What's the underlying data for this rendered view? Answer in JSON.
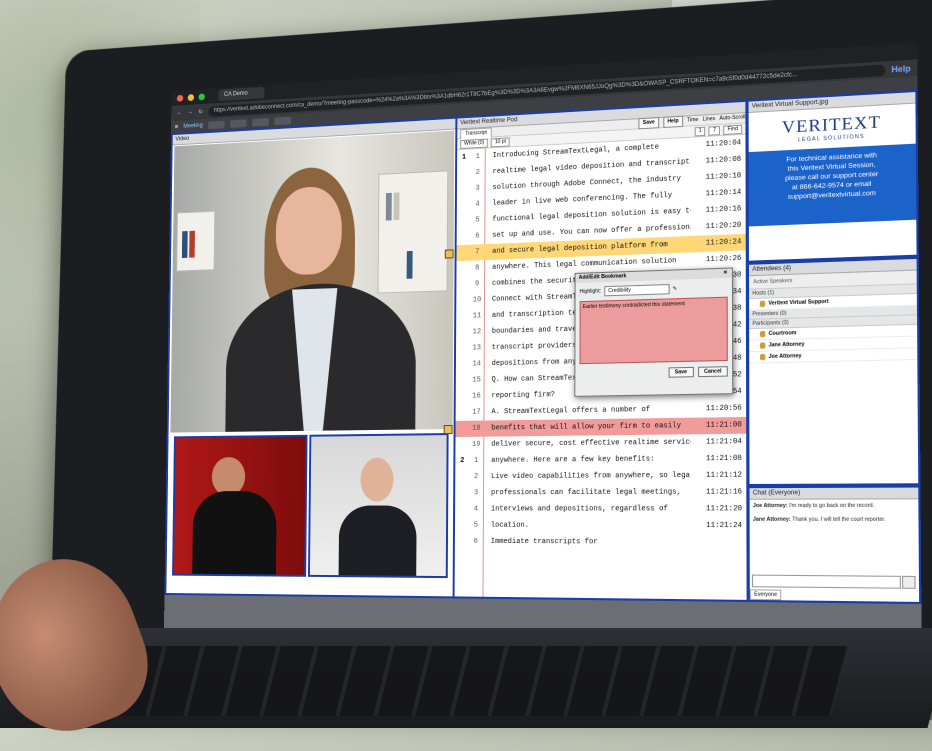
{
  "browser": {
    "tab_title": "CA Demo",
    "url": "https://veritext.adobeconnect.com/ca_demo/?meeting-passcode=%24%2a%3A%3Dbtx%3A1dbH62r1T8C7bEg%3D%3D%3A3A6Evgw%2FM6XN65JJoQg%3D%3D&OWASP_CSRFTOKEN=c7a9c5f0d0d44772c5de2cfc...",
    "help_label": "Help"
  },
  "appbar": {
    "meeting_label": "Meeting"
  },
  "video_pod": {
    "title": "Video"
  },
  "transcript_pod": {
    "title": "Veritext Realtime Pod",
    "tab": "Transcript",
    "save": "Save",
    "help": "Help",
    "time": "Time",
    "lines": "Lines",
    "autoscroll": "Auto-Scroll",
    "color_select": "White (0)",
    "size_select": "10 pt",
    "page_number": "1",
    "line_number": "7",
    "find_placeholder": "Find"
  },
  "transcript_lines": [
    {
      "page": "1",
      "line": "1",
      "text": "Introducing StreamTextLegal, a complete",
      "time": "11:20:04",
      "hl": ""
    },
    {
      "page": "",
      "line": "2",
      "text": "realtime legal video deposition and transcription",
      "time": "11:20:08",
      "hl": ""
    },
    {
      "page": "",
      "line": "3",
      "text": "solution through Adobe Connect, the industry",
      "time": "11:20:10",
      "hl": ""
    },
    {
      "page": "",
      "line": "4",
      "text": "leader in live web conferencing.  The fully",
      "time": "11:20:14",
      "hl": ""
    },
    {
      "page": "",
      "line": "5",
      "text": "functional legal deposition solution is easy to",
      "time": "11:20:16",
      "hl": ""
    },
    {
      "page": "",
      "line": "6",
      "text": "set up and use.  You can now offer a professional",
      "time": "11:20:20",
      "hl": ""
    },
    {
      "page": "",
      "line": "7",
      "text": "and secure legal deposition platform from",
      "time": "11:20:24",
      "hl": "yellow"
    },
    {
      "page": "",
      "line": "8",
      "text": "anywhere.  This legal communication solution",
      "time": "11:20:26",
      "hl": ""
    },
    {
      "page": "",
      "line": "9",
      "text": "combines the security and functionality of Adobe",
      "time": "11:20:30",
      "hl": ""
    },
    {
      "page": "",
      "line": "10",
      "text": "Connect with StreamText.Ne",
      "time": "34",
      "hl": ""
    },
    {
      "page": "",
      "line": "11",
      "text": "and transcription technolo",
      "time": "38",
      "hl": ""
    },
    {
      "page": "",
      "line": "12",
      "text": "boundaries and travel requ",
      "time": "42",
      "hl": ""
    },
    {
      "page": "",
      "line": "13",
      "text": "transcript providers can i",
      "time": "46",
      "hl": ""
    },
    {
      "page": "",
      "line": "14",
      "text": "depositions from anywhere.",
      "time": "48",
      "hl": ""
    },
    {
      "page": "",
      "line": "15",
      "text": "Q.  How can StreamTextl",
      "time": "52",
      "hl": ""
    },
    {
      "page": "",
      "line": "16",
      "text": "reporting firm?",
      "time": "54",
      "hl": ""
    },
    {
      "page": "",
      "line": "17",
      "text": "A.  StreamTextLegal offers a number of",
      "time": "11:20:56",
      "hl": ""
    },
    {
      "page": "",
      "line": "18",
      "text": "benefits that will allow your firm to easily",
      "time": "11:21:00",
      "hl": "red"
    },
    {
      "page": "",
      "line": "19",
      "text": "deliver secure, cost effective realtime services",
      "time": "11:21:04",
      "hl": ""
    },
    {
      "page": "2",
      "line": "1",
      "text": "anywhere.  Here are a few key benefits:",
      "time": "11:21:08",
      "hl": ""
    },
    {
      "page": "",
      "line": "2",
      "text": "Live video capabilities from anywhere, so legal",
      "time": "11:21:12",
      "hl": ""
    },
    {
      "page": "",
      "line": "3",
      "text": "professionals can facilitate legal meetings,",
      "time": "11:21:16",
      "hl": ""
    },
    {
      "page": "",
      "line": "4",
      "text": "interviews and depositions, regardless of",
      "time": "11:21:20",
      "hl": ""
    },
    {
      "page": "",
      "line": "5",
      "text": "location.",
      "time": "11:21:24",
      "hl": ""
    },
    {
      "page": "",
      "line": "6",
      "text": "Immediate transcripts for",
      "time": "",
      "hl": ""
    }
  ],
  "bookmark_dialog": {
    "title": "Add/Edit Bookmark",
    "highlight_label": "Highlight:",
    "highlight_value": "Credibility",
    "note": "Earlier testimony contradicted this statement",
    "save": "Save",
    "cancel": "Cancel"
  },
  "support_pod": {
    "title": "Veritext Virtual Support.jpg",
    "brand": "VERITEXT",
    "tagline": "LEGAL SOLUTIONS",
    "text_1": "For technical assistance with",
    "text_2": "this Veritext Virtual Session,",
    "text_3": "please call our support center",
    "text_4": "at 866-642-9574 or email",
    "text_5": "support@veritextvirtual.com"
  },
  "attendees_pod": {
    "title": "Attendees",
    "count": "(4)",
    "active_speakers": "Active Speakers",
    "hosts": "Hosts (1)",
    "host_1": "Veritext Virtual Support",
    "presenters": "Presenters (0)",
    "participants": "Participants (3)",
    "p1": "Courtroom",
    "p2": "Jane Attorney",
    "p3": "Joe Attorney"
  },
  "chat_pod": {
    "title": "Chat",
    "scope": "(Everyone)",
    "m1_name": "Joe Attorney:",
    "m1_text": "I'm ready to go back on the record.",
    "m2_name": "Jane Attorney:",
    "m2_text": "Thank you.  I will tell the court reporter.",
    "tab": "Everyone"
  },
  "colors": {
    "pod_border": "#1a3ea8",
    "highlight_yellow": "#ffd777",
    "highlight_red": "#f29b9b",
    "brand_blue": "#1c63c9"
  }
}
